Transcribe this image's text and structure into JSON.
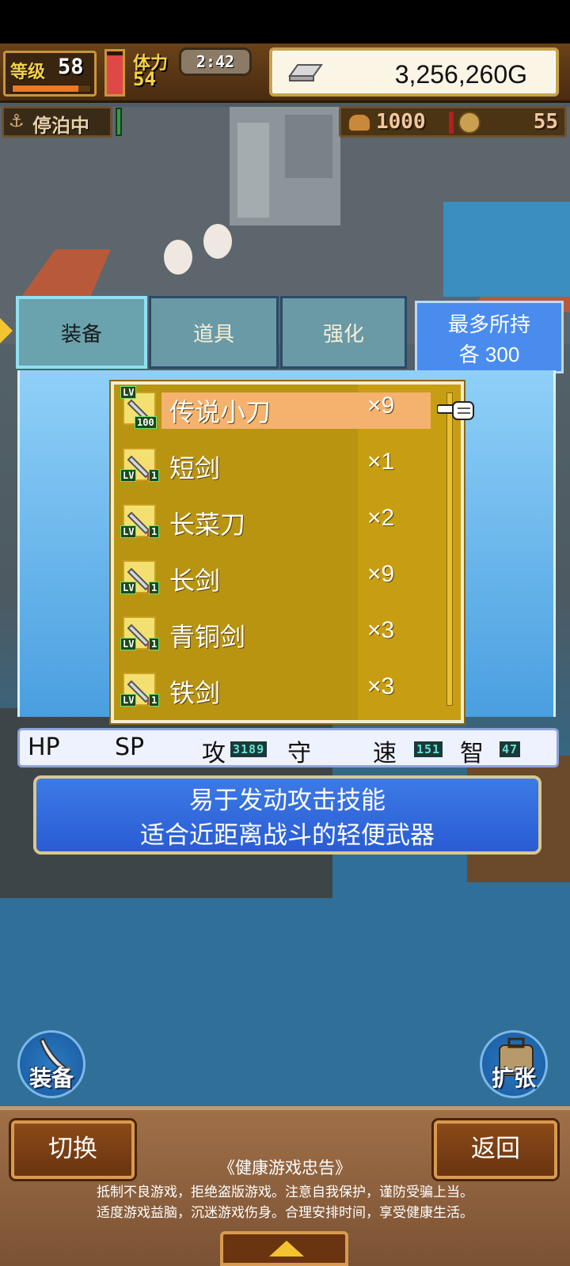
{
  "status": {
    "level_label": "等级",
    "level": "58",
    "level_progress": 0.85,
    "stamina_label": "体力",
    "stamina": "54",
    "stamina_fill": 0.9,
    "clock": "2:42",
    "gold": "3,256,260G"
  },
  "port": {
    "anchor_label": "停泊中",
    "food": "1000",
    "coins": "55"
  },
  "tabs": [
    {
      "label": "装备",
      "selected": true
    },
    {
      "label": "道具",
      "selected": false
    },
    {
      "label": "强化",
      "selected": false
    }
  ],
  "max_hold": {
    "line1": "最多所持",
    "line2": "各 300"
  },
  "items": [
    {
      "name": "传说小刀",
      "qty": "×9",
      "lv_label": "LV",
      "lv": "100",
      "selected": true
    },
    {
      "name": "短剑",
      "qty": "×1",
      "lv_label": "LV",
      "lv": "1",
      "selected": false
    },
    {
      "name": "长菜刀",
      "qty": "×2",
      "lv_label": "LV",
      "lv": "1",
      "selected": false
    },
    {
      "name": "长剑",
      "qty": "×9",
      "lv_label": "LV",
      "lv": "1",
      "selected": false
    },
    {
      "name": "青铜剑",
      "qty": "×3",
      "lv_label": "LV",
      "lv": "1",
      "selected": false
    },
    {
      "name": "铁剑",
      "qty": "×3",
      "lv_label": "LV",
      "lv": "1",
      "selected": false
    }
  ],
  "stats": {
    "hp_label": "HP",
    "sp_label": "SP",
    "atk_label": "攻",
    "atk": "3189",
    "def_label": "守",
    "spd_label": "速",
    "spd": "151",
    "int_label": "智",
    "int": "47"
  },
  "description": {
    "line1": "易于发动攻击技能",
    "line2": "适合近距离战斗的轻便武器"
  },
  "round_buttons": {
    "equip": "装备",
    "expand": "扩张"
  },
  "bottom": {
    "switch": "切换",
    "back": "返回",
    "health_title": "《健康游戏忠告》",
    "health_line1": "抵制不良游戏，拒绝盗版游戏。注意自我保护，谨防受骗上当。",
    "health_line2": "适度游戏益脑，沉迷游戏伤身。合理安排时间，享受健康生活。"
  },
  "colors": {
    "selected_row": "#f4b26e",
    "list_bg": "#b89410",
    "panel_blue": "#4a9fe0"
  }
}
